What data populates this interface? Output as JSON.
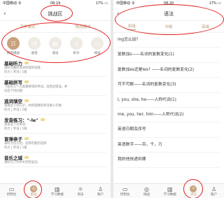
{
  "left": {
    "status": {
      "carrier": "中国移动 令",
      "time": "08:19",
      "battery": "17% ▭"
    },
    "nav": {
      "back": "‹",
      "title": "挑战区"
    },
    "tabs": [
      {
        "label": "可学模式"
      },
      {
        "label": "挑战模式"
      }
    ],
    "mode_icons": [
      {
        "label": "所有挑战",
        "glyph": "☷",
        "icon": "grid-icon"
      },
      {
        "label": "会话",
        "glyph": "◔",
        "icon": "chat-icon"
      },
      {
        "label": "语法",
        "glyph": "▤",
        "icon": "book-icon"
      },
      {
        "label": "听力",
        "glyph": "♫",
        "icon": "headphone-icon"
      },
      {
        "label": "阅读",
        "glyph": "▭",
        "icon": "read-icon"
      }
    ],
    "items": [
      {
        "title": "基础听力",
        "desc1": "请听完整的英语听取的词组:",
        "desc2": "听力 | 单词 | 1级"
      },
      {
        "title": "基础拼写",
        "desc1": "下面有三个大家都拼错的单词。选择出错误，并",
        "desc2": "向答下列问题:"
      },
      {
        "title": "选词填空",
        "desc1": "请填读下列句子，并将遗憾的单词填入空格:",
        "desc2": "听力 | 单词 | 1级"
      },
      {
        "title": "发音练习：\"-le\"",
        "desc1": "请读读下列单词:",
        "desc2": "听力 | 单词 | 1级"
      },
      {
        "title": "盲弹亲子",
        "desc1": "请听完句子后，选择可能的选择:",
        "desc2": "听力 | 单词 | 1级"
      },
      {
        "title": "音乐之城",
        "desc1": "请听完下列中文然后说出:",
        "desc2": ""
      }
    ],
    "tabbar": [
      {
        "label": "控制台",
        "glyph": "▭"
      },
      {
        "label": "挑战",
        "glyph": "◎"
      },
      {
        "label": "学习数据",
        "glyph": "▥"
      },
      {
        "label": "语法",
        "glyph": "☼"
      },
      {
        "label": "账户",
        "glyph": "♙"
      }
    ]
  },
  "right": {
    "status": {
      "carrier": "中国移动 令",
      "time": "08:20",
      "battery": "17% ▭"
    },
    "nav": {
      "back": "‹",
      "title": "语法"
    },
    "tabs": [
      {
        "label": "初级"
      },
      {
        "label": "中级"
      },
      {
        "label": "高级"
      }
    ],
    "items": [
      "ing怎么加?",
      "复数加s——名词的复数变化(1)",
      "复数加es还是ies? ——名词的复数变化(2)",
      "可不可数——名词的复数变化(3)",
      "I, you, she, he——人称代词(1)",
      "me, you, her, him——人称代词(2)",
      "英语日期及序号",
      "英语数字——百，千，万",
      "我的他快递到哪"
    ],
    "tabbar": [
      {
        "label": "控制台",
        "glyph": "▭"
      },
      {
        "label": "挑战",
        "glyph": "◎"
      },
      {
        "label": "学习数据",
        "glyph": "▥"
      },
      {
        "label": "语法",
        "glyph": "☼"
      },
      {
        "label": "账户",
        "glyph": "♙"
      }
    ]
  },
  "colors": {
    "accent": "#c8a27c",
    "annotation": "#e02020"
  }
}
